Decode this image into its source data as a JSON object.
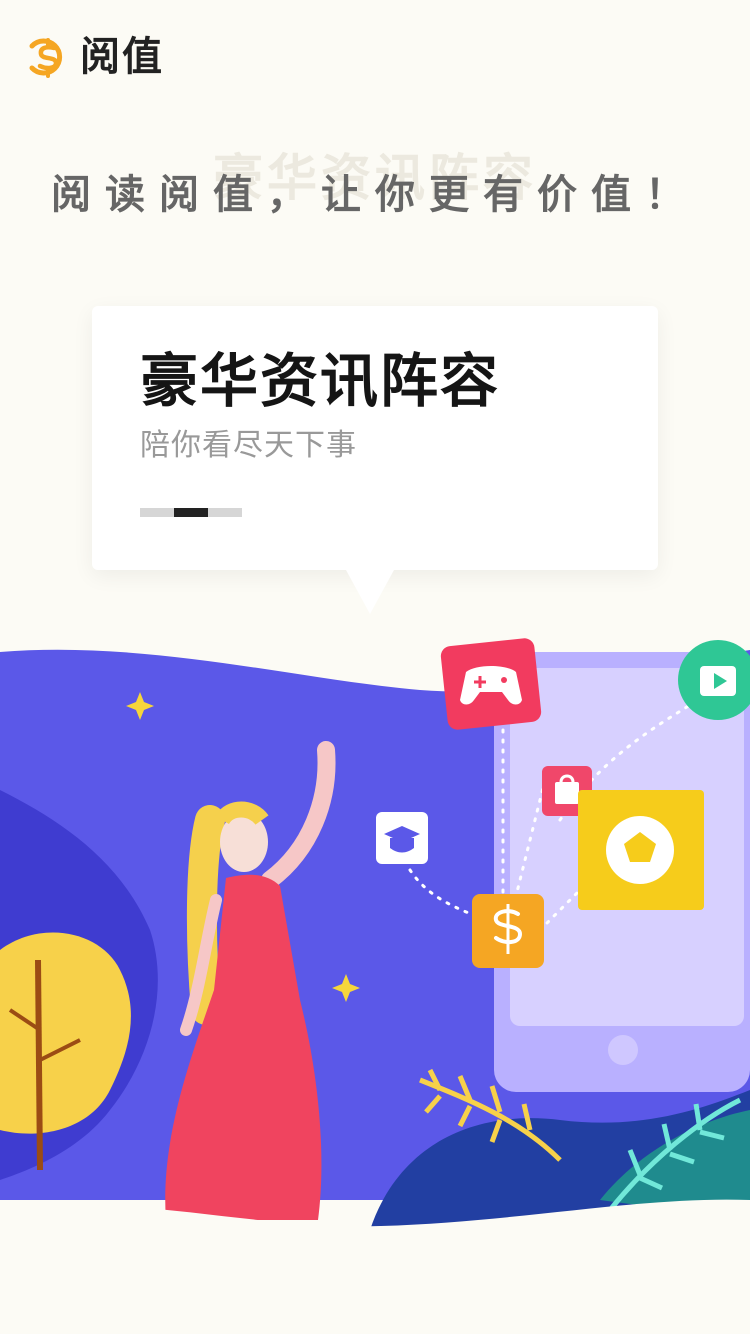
{
  "app": {
    "name": "阅值",
    "logo_icon": "dollar-coin-icon"
  },
  "ghost_title": "豪华资讯阵容",
  "slogan": "阅读阅值，让你更有价值！",
  "card": {
    "title": "豪华资讯阵容",
    "subtitle": "陪你看尽天下事",
    "pager": {
      "total": 3,
      "active": 2
    }
  },
  "illustration": {
    "icons": [
      "game-controller-icon",
      "video-play-icon",
      "shopping-bag-icon",
      "graduation-cap-icon",
      "soccer-ball-icon",
      "dollar-coin-icon"
    ],
    "colors": {
      "accent": "#f5a623",
      "sky": "#5b58e8",
      "dress": "#f0445f",
      "card_yellow": "#f6cc1b"
    }
  }
}
